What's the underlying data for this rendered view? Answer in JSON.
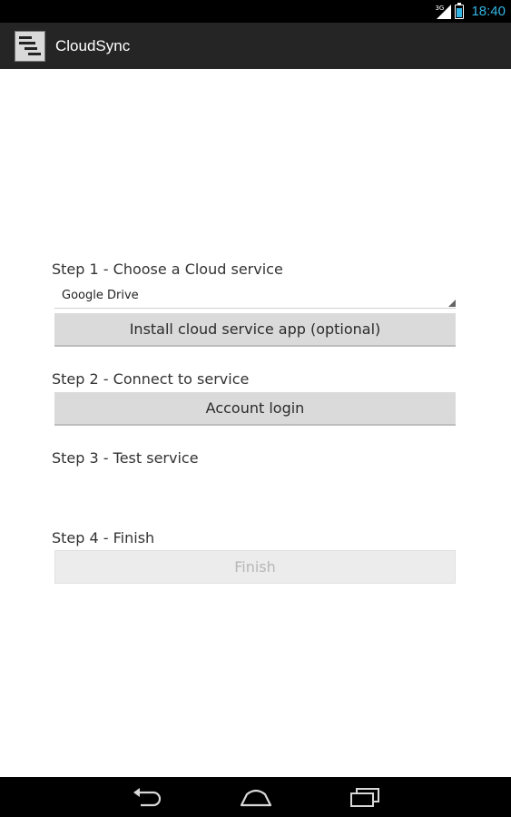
{
  "status_bar": {
    "network_type": "3G",
    "time": "18:40"
  },
  "action_bar": {
    "title": "CloudSync",
    "icon": "app-logo-icon"
  },
  "steps": {
    "step1_label": "Step 1 - Choose a Cloud service",
    "service_selected": "Google Drive",
    "install_button": "Install cloud service app (optional)",
    "step2_label": "Step 2 - Connect to service",
    "login_button": "Account login",
    "step3_label": "Step 3 - Test service",
    "step4_label": "Step 4 - Finish",
    "finish_button": "Finish"
  },
  "nav_bar": {
    "icons": [
      "back-icon",
      "home-icon",
      "recent-apps-icon"
    ]
  },
  "colors": {
    "accent": "#33b5e5",
    "action_bar": "#252525",
    "button": "#dadada"
  }
}
